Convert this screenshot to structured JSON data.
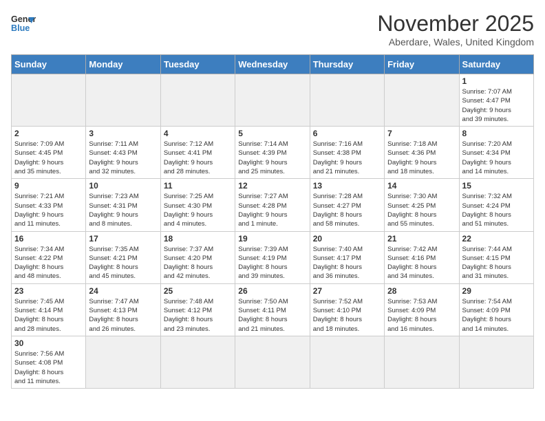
{
  "header": {
    "logo_general": "General",
    "logo_blue": "Blue",
    "month_title": "November 2025",
    "location": "Aberdare, Wales, United Kingdom"
  },
  "weekdays": [
    "Sunday",
    "Monday",
    "Tuesday",
    "Wednesday",
    "Thursday",
    "Friday",
    "Saturday"
  ],
  "weeks": [
    [
      {
        "day": "",
        "info": ""
      },
      {
        "day": "",
        "info": ""
      },
      {
        "day": "",
        "info": ""
      },
      {
        "day": "",
        "info": ""
      },
      {
        "day": "",
        "info": ""
      },
      {
        "day": "",
        "info": ""
      },
      {
        "day": "1",
        "info": "Sunrise: 7:07 AM\nSunset: 4:47 PM\nDaylight: 9 hours\nand 39 minutes."
      }
    ],
    [
      {
        "day": "2",
        "info": "Sunrise: 7:09 AM\nSunset: 4:45 PM\nDaylight: 9 hours\nand 35 minutes."
      },
      {
        "day": "3",
        "info": "Sunrise: 7:11 AM\nSunset: 4:43 PM\nDaylight: 9 hours\nand 32 minutes."
      },
      {
        "day": "4",
        "info": "Sunrise: 7:12 AM\nSunset: 4:41 PM\nDaylight: 9 hours\nand 28 minutes."
      },
      {
        "day": "5",
        "info": "Sunrise: 7:14 AM\nSunset: 4:39 PM\nDaylight: 9 hours\nand 25 minutes."
      },
      {
        "day": "6",
        "info": "Sunrise: 7:16 AM\nSunset: 4:38 PM\nDaylight: 9 hours\nand 21 minutes."
      },
      {
        "day": "7",
        "info": "Sunrise: 7:18 AM\nSunset: 4:36 PM\nDaylight: 9 hours\nand 18 minutes."
      },
      {
        "day": "8",
        "info": "Sunrise: 7:20 AM\nSunset: 4:34 PM\nDaylight: 9 hours\nand 14 minutes."
      }
    ],
    [
      {
        "day": "9",
        "info": "Sunrise: 7:21 AM\nSunset: 4:33 PM\nDaylight: 9 hours\nand 11 minutes."
      },
      {
        "day": "10",
        "info": "Sunrise: 7:23 AM\nSunset: 4:31 PM\nDaylight: 9 hours\nand 8 minutes."
      },
      {
        "day": "11",
        "info": "Sunrise: 7:25 AM\nSunset: 4:30 PM\nDaylight: 9 hours\nand 4 minutes."
      },
      {
        "day": "12",
        "info": "Sunrise: 7:27 AM\nSunset: 4:28 PM\nDaylight: 9 hours\nand 1 minute."
      },
      {
        "day": "13",
        "info": "Sunrise: 7:28 AM\nSunset: 4:27 PM\nDaylight: 8 hours\nand 58 minutes."
      },
      {
        "day": "14",
        "info": "Sunrise: 7:30 AM\nSunset: 4:25 PM\nDaylight: 8 hours\nand 55 minutes."
      },
      {
        "day": "15",
        "info": "Sunrise: 7:32 AM\nSunset: 4:24 PM\nDaylight: 8 hours\nand 51 minutes."
      }
    ],
    [
      {
        "day": "16",
        "info": "Sunrise: 7:34 AM\nSunset: 4:22 PM\nDaylight: 8 hours\nand 48 minutes."
      },
      {
        "day": "17",
        "info": "Sunrise: 7:35 AM\nSunset: 4:21 PM\nDaylight: 8 hours\nand 45 minutes."
      },
      {
        "day": "18",
        "info": "Sunrise: 7:37 AM\nSunset: 4:20 PM\nDaylight: 8 hours\nand 42 minutes."
      },
      {
        "day": "19",
        "info": "Sunrise: 7:39 AM\nSunset: 4:19 PM\nDaylight: 8 hours\nand 39 minutes."
      },
      {
        "day": "20",
        "info": "Sunrise: 7:40 AM\nSunset: 4:17 PM\nDaylight: 8 hours\nand 36 minutes."
      },
      {
        "day": "21",
        "info": "Sunrise: 7:42 AM\nSunset: 4:16 PM\nDaylight: 8 hours\nand 34 minutes."
      },
      {
        "day": "22",
        "info": "Sunrise: 7:44 AM\nSunset: 4:15 PM\nDaylight: 8 hours\nand 31 minutes."
      }
    ],
    [
      {
        "day": "23",
        "info": "Sunrise: 7:45 AM\nSunset: 4:14 PM\nDaylight: 8 hours\nand 28 minutes."
      },
      {
        "day": "24",
        "info": "Sunrise: 7:47 AM\nSunset: 4:13 PM\nDaylight: 8 hours\nand 26 minutes."
      },
      {
        "day": "25",
        "info": "Sunrise: 7:48 AM\nSunset: 4:12 PM\nDaylight: 8 hours\nand 23 minutes."
      },
      {
        "day": "26",
        "info": "Sunrise: 7:50 AM\nSunset: 4:11 PM\nDaylight: 8 hours\nand 21 minutes."
      },
      {
        "day": "27",
        "info": "Sunrise: 7:52 AM\nSunset: 4:10 PM\nDaylight: 8 hours\nand 18 minutes."
      },
      {
        "day": "28",
        "info": "Sunrise: 7:53 AM\nSunset: 4:09 PM\nDaylight: 8 hours\nand 16 minutes."
      },
      {
        "day": "29",
        "info": "Sunrise: 7:54 AM\nSunset: 4:09 PM\nDaylight: 8 hours\nand 14 minutes."
      }
    ],
    [
      {
        "day": "30",
        "info": "Sunrise: 7:56 AM\nSunset: 4:08 PM\nDaylight: 8 hours\nand 11 minutes."
      },
      {
        "day": "",
        "info": ""
      },
      {
        "day": "",
        "info": ""
      },
      {
        "day": "",
        "info": ""
      },
      {
        "day": "",
        "info": ""
      },
      {
        "day": "",
        "info": ""
      },
      {
        "day": "",
        "info": ""
      }
    ]
  ]
}
